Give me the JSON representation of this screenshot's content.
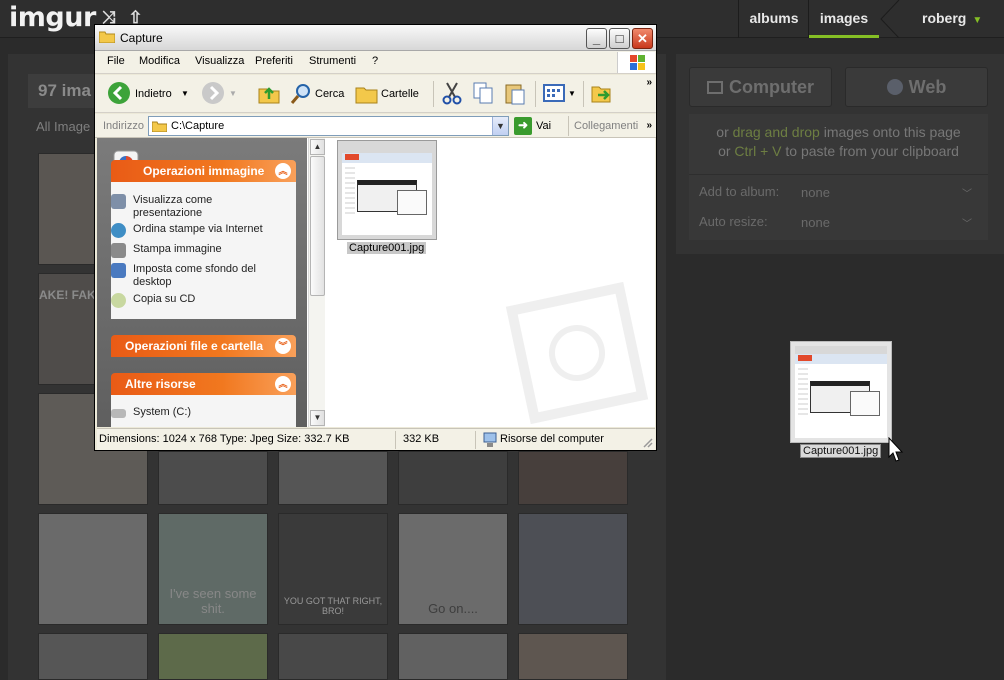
{
  "imgur": {
    "logo": "imgur",
    "nav": {
      "albums": "albums",
      "images": "images",
      "user": "roberg"
    },
    "image_count": "97 ima",
    "all_images_label": "All Image",
    "upload": {
      "computer_button": "Computer",
      "web_button": "Web",
      "hint_line1_pre": "or ",
      "hint_line1_hl": "drag and drop",
      "hint_line1_post": " images onto this page",
      "hint_line2_pre": "or ",
      "hint_line2_hl": "Ctrl + V",
      "hint_line2_post": " to paste from your clipboard",
      "add_to_album_label": "Add to album:",
      "add_to_album_value": "none",
      "auto_resize_label": "Auto resize:",
      "auto_resize_value": "none"
    },
    "thumb_captions": {
      "fake": "AKE! FAKE!",
      "seen": "I've seen some shit.",
      "bro": "YOU GOT THAT RIGHT, BRO!",
      "goon": "Go on...."
    },
    "dragged_file": "Capture001.jpg"
  },
  "explorer": {
    "title": "Capture",
    "menu": [
      "File",
      "Modifica",
      "Visualizza",
      "Preferiti",
      "Strumenti",
      "?"
    ],
    "toolbar": {
      "back": "Indietro",
      "search": "Cerca",
      "folders": "Cartelle"
    },
    "address": {
      "label": "Indirizzo",
      "value": "C:\\Capture",
      "go": "Vai",
      "links": "Collegamenti"
    },
    "tasks": {
      "image_ops_title": "Operazioni immagine",
      "image_ops": [
        "Visualizza come presentazione",
        "Ordina stampe via Internet",
        "Stampa immagine",
        "Imposta come sfondo del desktop",
        "Copia su CD"
      ],
      "file_ops_title": "Operazioni file e cartella",
      "other_title": "Altre risorse",
      "other": [
        "System (C:)"
      ]
    },
    "file": {
      "name": "Capture001.jpg"
    },
    "status": {
      "info": "Dimensions: 1024 x 768 Type: Jpeg Size: 332.7 KB",
      "size": "332 KB",
      "location": "Risorse del computer"
    }
  },
  "colors": {
    "imgur_accent": "#85bf25",
    "xp_task_header": "#e95b16"
  },
  "icons": [
    "shuffle-icon",
    "upload-icon",
    "monitor-icon",
    "globe-icon",
    "folder-icon",
    "back-icon",
    "forward-icon",
    "up-folder-icon",
    "search-icon",
    "cut-icon",
    "copy-icon",
    "paste-icon",
    "views-icon",
    "move-icon",
    "go-icon",
    "drive-icon",
    "cursor-icon"
  ]
}
